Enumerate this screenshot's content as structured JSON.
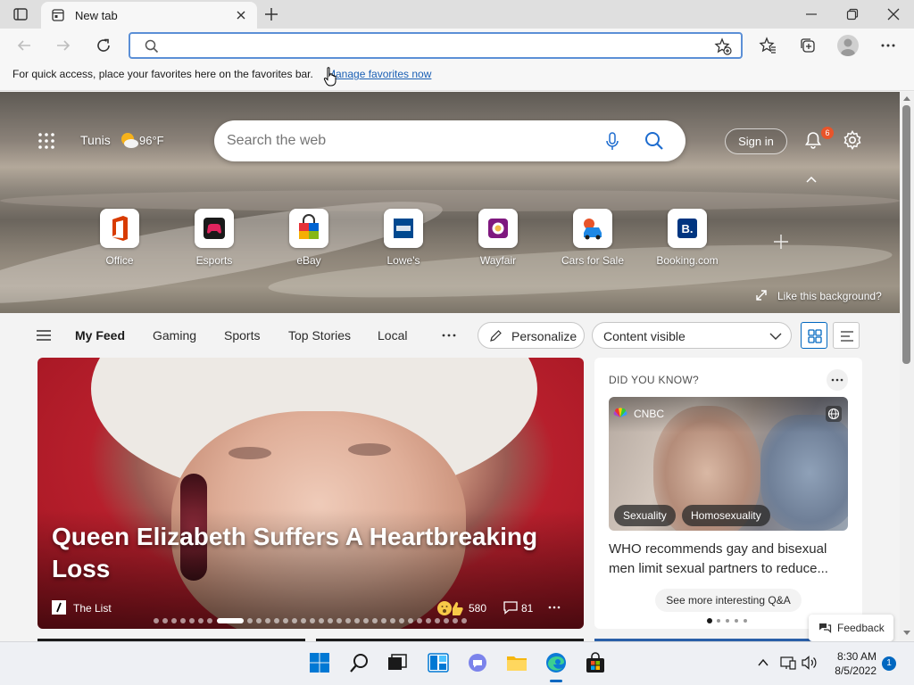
{
  "browser": {
    "tab_title": "New tab",
    "address_value": "",
    "favorites_bar_text": "For quick access, place your favorites here on the favorites bar.",
    "favorites_bar_link": "Manage favorites now"
  },
  "hero": {
    "location": "Tunis",
    "temperature": "96°F",
    "search_placeholder": "Search the web",
    "signin_label": "Sign in",
    "notification_count": "6",
    "like_background": "Like this background?",
    "quick_links": [
      {
        "label": "Office",
        "icon": "office-icon",
        "color": "#d83b01"
      },
      {
        "label": "Esports",
        "icon": "esports-icon",
        "color": "#1a1a1a"
      },
      {
        "label": "eBay",
        "icon": "ebay-icon",
        "color": "#0064d2"
      },
      {
        "label": "Lowe's",
        "icon": "lowes-icon",
        "color": "#004990"
      },
      {
        "label": "Wayfair",
        "icon": "wayfair-icon",
        "color": "#7f187f"
      },
      {
        "label": "Cars for Sale",
        "icon": "car-icon",
        "color": "#1e88e5"
      },
      {
        "label": "Booking.com",
        "icon": "booking-icon",
        "color": "#003580"
      }
    ]
  },
  "feed_nav": {
    "items": [
      "My Feed",
      "Gaming",
      "Sports",
      "Top Stories",
      "Local"
    ],
    "personalize_label": "Personalize",
    "content_select_value": "Content visible"
  },
  "main_card": {
    "headline": "Queen Elizabeth Suffers A Heartbreaking Loss",
    "source": "The List",
    "reactions": "580",
    "comments": "81"
  },
  "side_card": {
    "heading": "DID YOU KNOW?",
    "source": "CNBC",
    "tags": [
      "Sexuality",
      "Homosexuality"
    ],
    "title": "WHO recommends gay and bisexual men limit sexual partners to reduce...",
    "more_label": "See more interesting Q&A"
  },
  "feedback_label": "Feedback",
  "taskbar": {
    "time": "8:30 AM",
    "date": "8/5/2022",
    "notification_count": "1"
  },
  "colors": {
    "accent": "#0067c0",
    "address_border": "#5b8fd6",
    "badge": "#e8542a"
  }
}
